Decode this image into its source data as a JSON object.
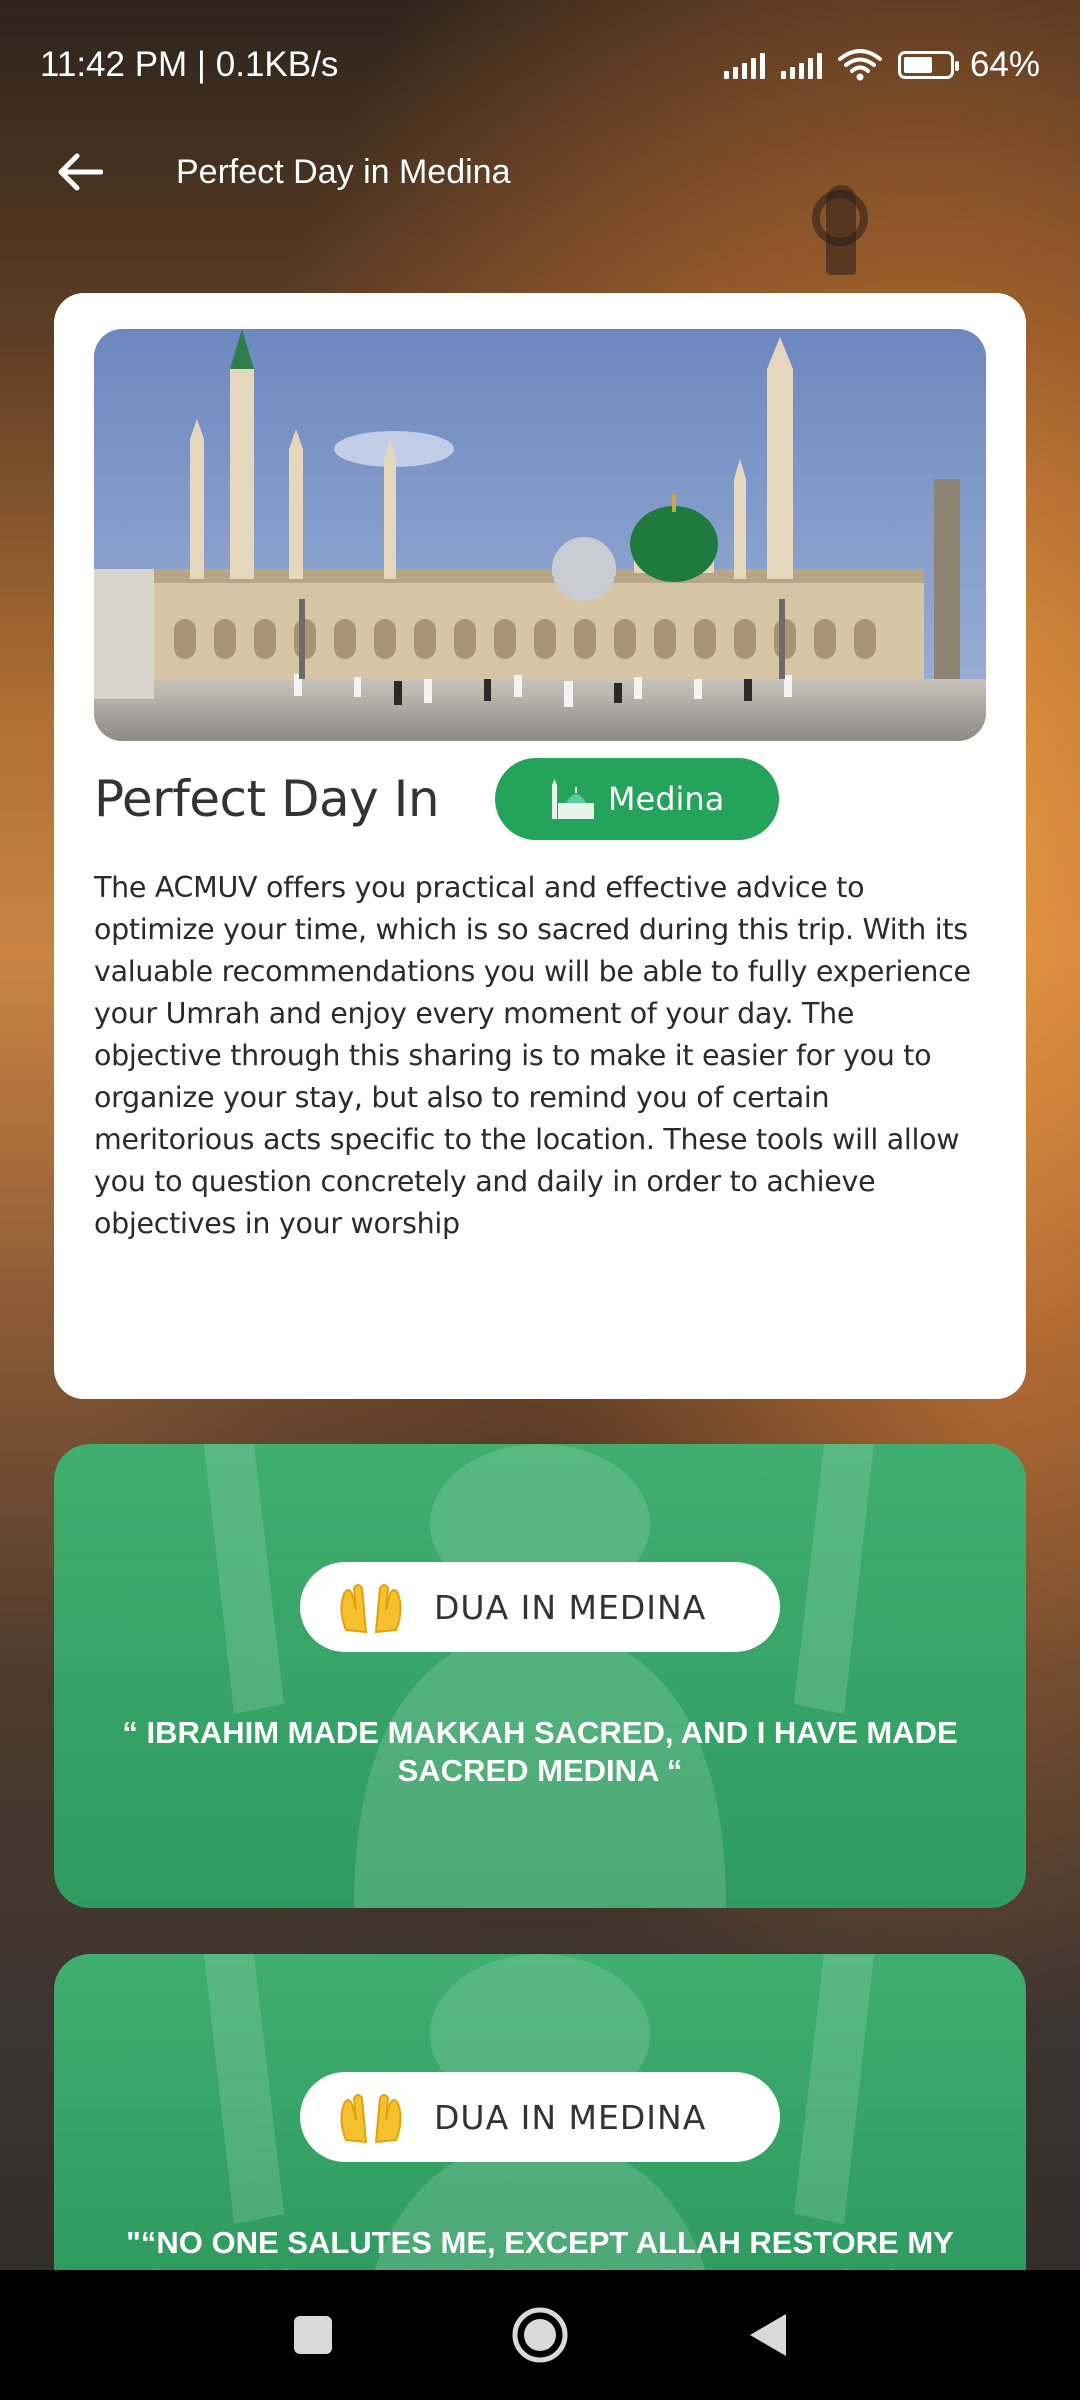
{
  "status_bar": {
    "time_speed": "11:42 PM | 0.1KB/s",
    "battery_text": "64%",
    "battery_level": 0.64
  },
  "app_bar": {
    "title": "Perfect Day in Medina",
    "back_icon": "arrow-left-icon"
  },
  "intro": {
    "image_alt": "Mosque in Medina",
    "heading": "Perfect Day In",
    "city_chip": "Medina",
    "city_icon": "mosque-icon",
    "description": "The ACMUV offers you practical and effective advice to optimize your time, which is so sacred during this trip. With its valuable recommendations you will be able to fully experience your Umrah and enjoy every moment of your day. The objective through this sharing is to make it easier for you to organize your stay, but also to remind you of certain meritorious acts specific to the location. These tools will allow you to question concretely and daily in order to achieve objectives in your worship"
  },
  "duas": [
    {
      "label": "DUA IN MEDINA",
      "icon": "praying-hands-icon",
      "quote": "“ IBRAHIM MADE MAKKAH SACRED, AND I HAVE MADE SACRED MEDINA “"
    },
    {
      "label": "DUA IN MEDINA",
      "icon": "praying-hands-icon",
      "quote": "\"“NO ONE SALUTES ME, EXCEPT ALLAH RESTORE MY SPIRIT SO THAT I RESPOND TO HIS SALUTATIONS. “"
    }
  ],
  "nav": {
    "recents_icon": "square-icon",
    "home_icon": "circle-icon",
    "back_icon": "triangle-back-icon"
  },
  "colors": {
    "accent_green": "#23a45a",
    "dua_green": "#35a366",
    "card_white": "#ffffff"
  }
}
